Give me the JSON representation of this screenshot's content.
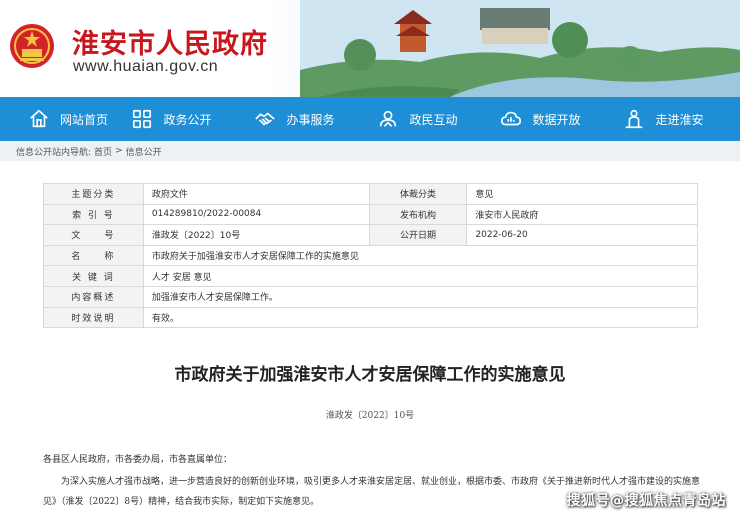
{
  "header": {
    "site_title": "淮安市人民政府",
    "site_url": "www.huaian.gov.cn"
  },
  "nav": {
    "items": [
      {
        "label": "网站首页",
        "icon": "home-icon"
      },
      {
        "label": "政务公开",
        "icon": "grid-icon"
      },
      {
        "label": "办事服务",
        "icon": "handshake-icon"
      },
      {
        "label": "政民互动",
        "icon": "interaction-icon"
      },
      {
        "label": "数据开放",
        "icon": "data-icon"
      },
      {
        "label": "走进淮安",
        "icon": "person-icon"
      }
    ],
    "bg_color": "#1e8fd6"
  },
  "breadcrumb": {
    "prefix": "信息公开站内导航:",
    "items": [
      "首页",
      "信息公开"
    ],
    "separator": ">"
  },
  "info_table": {
    "rows": [
      {
        "label": "主题分类",
        "value": "政府文件",
        "label2": "体裁分类",
        "value2": "意见"
      },
      {
        "label": "索 引 号",
        "value": "014289810/2022-00084",
        "label2": "发布机构",
        "value2": "淮安市人民政府"
      },
      {
        "label": "文　　号",
        "value": "淮政发〔2022〕10号",
        "label2": "公开日期",
        "value2": "2022-06-20"
      },
      {
        "label": "名　　称",
        "value": "市政府关于加强淮安市人才安居保障工作的实施意见"
      },
      {
        "label": "关 键 词",
        "value": "人才 安居 意见"
      },
      {
        "label": "内容概述",
        "value": "加强淮安市人才安居保障工作。"
      },
      {
        "label": "时效说明",
        "value": "有效。"
      }
    ]
  },
  "article": {
    "title": "市政府关于加强淮安市人才安居保障工作的实施意见",
    "doc_number": "淮政发〔2022〕10号",
    "para1": "各县区人民政府，市各委办局，市各直属单位：",
    "para2": "为深入实施人才强市战略，进一步营造良好的创新创业环境，吸引更多人才来淮安居定居、就业创业，根据市委、市政府《关于推进新时代人才强市建设的实施意见》（淮发〔2022〕8号）精神，结合我市实际，制定如下实施意见。"
  },
  "watermark": "搜狐号@搜狐焦点青岛站",
  "colors": {
    "brand_red": "#c8161d",
    "nav_blue": "#1e8fd6"
  }
}
